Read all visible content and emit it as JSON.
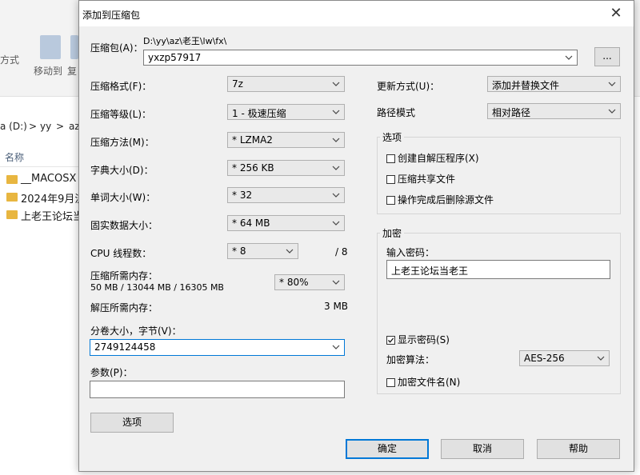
{
  "explorer": {
    "ribbon_left_label": "方式",
    "ribbon_move_label": "移动到",
    "ribbon_copy_label": "复",
    "address_drive": "a (D:)",
    "address_sep1": ">",
    "address_yy": "yy",
    "address_sep2": ">",
    "address_az": "az",
    "column_name": "名称",
    "items": [
      "__MACOSX",
      "2024年9月流",
      "上老王论坛当"
    ]
  },
  "dialog": {
    "title": "添加到压缩包",
    "archive_label": "压缩包(A)：",
    "archive_path": "D:\\yy\\az\\老王\\lw\\fx\\",
    "archive_name": "yxzp57917",
    "browse_label": "...",
    "format_label": "压缩格式(F)：",
    "format_value": "7z",
    "level_label": "压缩等级(L)：",
    "level_value": "1 - 极速压缩",
    "method_label": "压缩方法(M)：",
    "method_value": "* LZMA2",
    "dict_label": "字典大小(D)：",
    "dict_value": "* 256 KB",
    "word_label": "单词大小(W)：",
    "word_value": "* 32",
    "solid_label": "固实数据大小：",
    "solid_value": "* 64 MB",
    "cpu_label": "CPU 线程数：",
    "cpu_value": "* 8",
    "cpu_total": "/ 8",
    "mem_label": "压缩所需内存：",
    "mem_detail": "50 MB / 13044 MB / 16305 MB",
    "mem_value": "* 80%",
    "demem_label": "解压所需内存：",
    "demem_value": "3 MB",
    "split_label": "分卷大小，字节(V)：",
    "split_value": "2749124458",
    "params_label": "参数(P)：",
    "params_value": "",
    "options_button": "选项",
    "update_label": "更新方式(U)：",
    "update_value": "添加并替换文件",
    "path_label": "路径模式",
    "path_value": "相对路径",
    "options_group": "选项",
    "opt_sfx": "创建自解压程序(X)",
    "opt_shared": "压缩共享文件",
    "opt_delete": "操作完成后删除源文件",
    "encrypt_group": "加密",
    "password_label": "输入密码：",
    "password_value": "上老王论坛当老王",
    "show_password": "显示密码(S)",
    "enc_method_label": "加密算法：",
    "enc_method_value": "AES-256",
    "enc_names": "加密文件名(N)",
    "ok_button": "确定",
    "cancel_button": "取消",
    "help_button": "帮助"
  }
}
